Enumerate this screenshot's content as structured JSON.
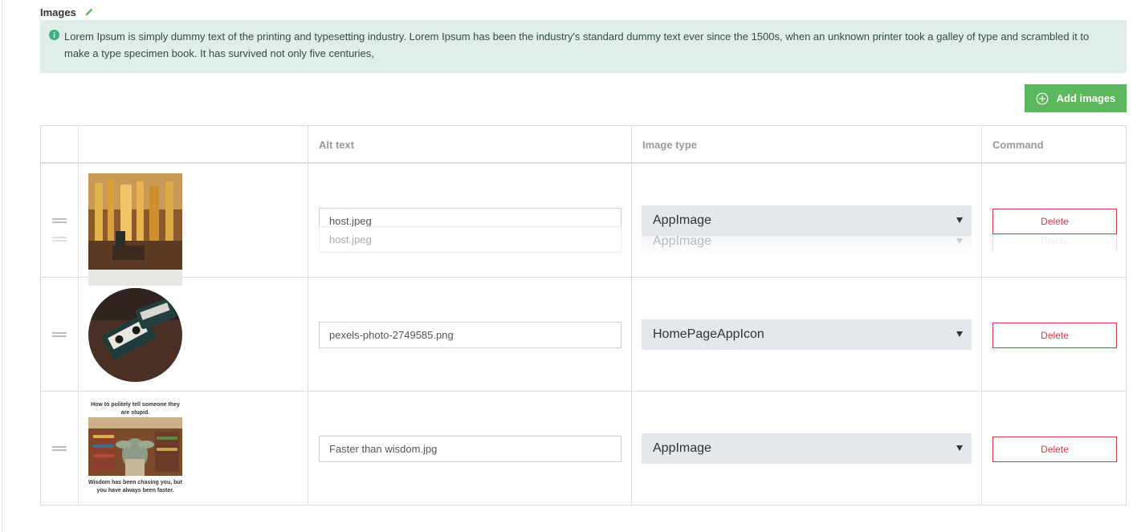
{
  "section": {
    "title": "Images"
  },
  "info": {
    "text": "Lorem Ipsum is simply dummy text of the printing and typesetting industry. Lorem Ipsum has been the industry's standard dummy text ever since the 1500s, when an unknown printer took a galley of type and scrambled it to make a type specimen book. It has survived not only five centuries,"
  },
  "toolbar": {
    "add_label": "Add images"
  },
  "columns": {
    "alt": "Alt text",
    "type": "Image type",
    "command": "Command"
  },
  "rows": [
    {
      "alt": "host.jpeg",
      "type": "AppImage",
      "delete_label": "Delete",
      "image": "photo-interior"
    },
    {
      "alt": "pexels-photo-2749585.png",
      "type": "HomePageAppIcon",
      "delete_label": "Delete",
      "image": "photo-cassette"
    },
    {
      "alt": "Faster than wisdom.jpg",
      "type": "AppImage",
      "delete_label": "Delete",
      "image": "meme-library",
      "caption_top": "How to politely tell someone they are stupid.",
      "caption_bottom": "Wisdom has been chasing you, but you have always been faster."
    }
  ],
  "drag_ghost": {
    "alt": "host.jpeg",
    "type": "AppImage",
    "delete_label": "Delete"
  },
  "colors": {
    "accent": "#5cb85c",
    "danger": "#d23a4a",
    "info_bg": "#e0eee9",
    "info_icon": "#3fae7d"
  }
}
